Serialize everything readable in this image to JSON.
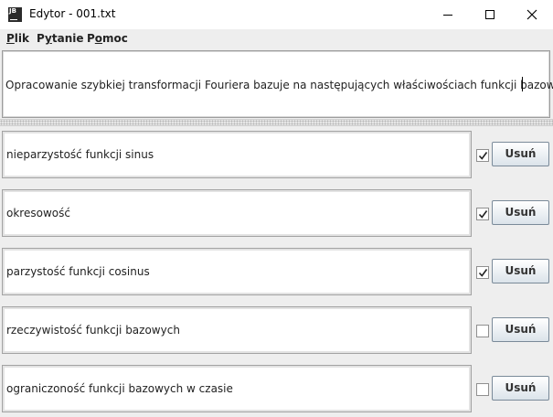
{
  "window": {
    "title": "Edytor - 001.txt",
    "app_icon_text": "JB"
  },
  "menu": [
    {
      "key": "P",
      "rest": "lik"
    },
    {
      "key": "y",
      "pre": "P",
      "rest": "tanie"
    },
    {
      "key": "o",
      "pre": "P",
      "rest": "moc"
    }
  ],
  "question": {
    "text": "Opracowanie szybkiej transformacji Fouriera bazuje na następujących właściwościach funkcji bazowych"
  },
  "answers": [
    {
      "text": "nieparzystość funkcji sinus",
      "checked": true,
      "delete_label": "Usuń"
    },
    {
      "text": "okresowość",
      "checked": true,
      "delete_label": "Usuń"
    },
    {
      "text": "parzystość funkcji cosinus",
      "checked": true,
      "delete_label": "Usuń"
    },
    {
      "text": "rzeczywistość funkcji bazowych",
      "checked": false,
      "delete_label": "Usuń"
    },
    {
      "text": "ograniczoność funkcji bazowych w czasie",
      "checked": false,
      "delete_label": "Usuń"
    }
  ]
}
